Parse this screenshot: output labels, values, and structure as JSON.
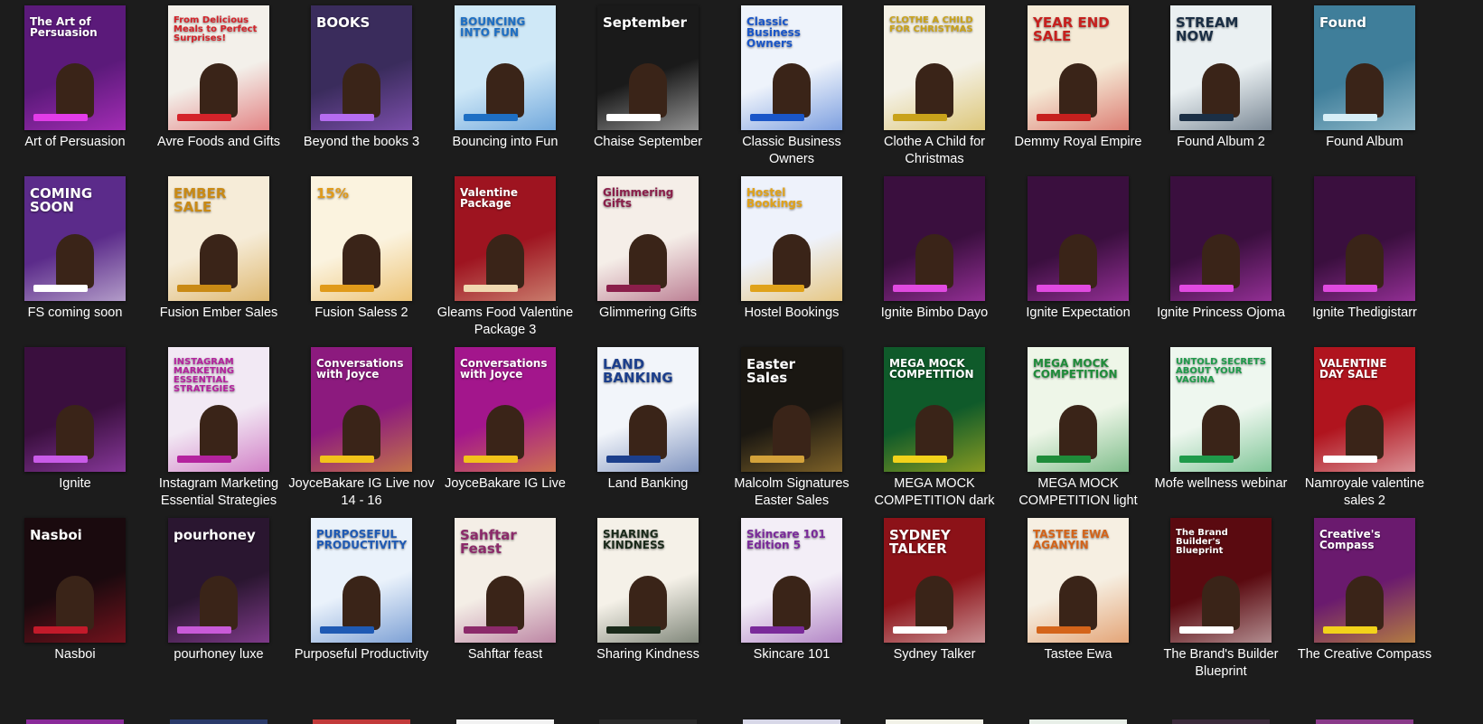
{
  "files": [
    {
      "label": "Art of Persuasion",
      "icon": "image-thumbnail-icon",
      "bg": "#5b1a7a",
      "accent": "#e23ce8",
      "headline": "The Art of Persuasion"
    },
    {
      "label": "Avre Foods and Gifts",
      "icon": "image-thumbnail-icon",
      "bg": "#f3f0ea",
      "accent": "#d4232a",
      "headline": "From Delicious Meals to Perfect Surprises!"
    },
    {
      "label": "Beyond the books 3",
      "icon": "image-thumbnail-icon",
      "bg": "#3a2c5c",
      "accent": "#b56cf0",
      "headline": "BOOKS"
    },
    {
      "label": "Bouncing into Fun",
      "icon": "image-thumbnail-icon",
      "bg": "#cfe8f7",
      "accent": "#1e6fc4",
      "headline": "BOUNCING INTO FUN"
    },
    {
      "label": "Chaise September",
      "icon": "image-thumbnail-icon",
      "bg": "#1a1a1a",
      "accent": "#ffffff",
      "headline": "September"
    },
    {
      "label": "Classic Business Owners",
      "icon": "image-thumbnail-icon",
      "bg": "#eef3fb",
      "accent": "#1a56c8",
      "headline": "Classic Business Owners"
    },
    {
      "label": "Clothe A Child for Christmas",
      "icon": "image-thumbnail-icon",
      "bg": "#f4f1e6",
      "accent": "#c9a21a",
      "headline": "CLOTHE A CHILD FOR CHRISTMAS"
    },
    {
      "label": "Demmy Royal Empire",
      "icon": "image-thumbnail-icon",
      "bg": "#f5ead6",
      "accent": "#c6201e",
      "headline": "YEAR END SALE"
    },
    {
      "label": "Found Album 2",
      "icon": "image-thumbnail-icon",
      "bg": "#eaf0f2",
      "accent": "#1b2f45",
      "headline": "STREAM NOW"
    },
    {
      "label": "Found Album",
      "icon": "image-thumbnail-icon",
      "bg": "#3f7e9a",
      "accent": "#d7eef6",
      "headline": "Found"
    },
    {
      "label": "FS coming soon",
      "icon": "image-thumbnail-icon",
      "bg": "#5b2b8a",
      "accent": "#ffffff",
      "headline": "COMING SOON"
    },
    {
      "label": "Fusion Ember Sales",
      "icon": "image-thumbnail-icon",
      "bg": "#f6ecd8",
      "accent": "#c98a15",
      "headline": "EMBER SALE"
    },
    {
      "label": "Fusion Saless 2",
      "icon": "image-thumbnail-icon",
      "bg": "#fbf3df",
      "accent": "#e09a1a",
      "headline": "15%"
    },
    {
      "label": "Gleams Food Valentine Package 3",
      "icon": "image-thumbnail-icon",
      "bg": "#9e1420",
      "accent": "#f0d8b0",
      "headline": "Valentine Package"
    },
    {
      "label": "Glimmering Gifts",
      "icon": "image-thumbnail-icon",
      "bg": "#f5eee8",
      "accent": "#8a1e4a",
      "headline": "Glimmering Gifts"
    },
    {
      "label": "Hostel Bookings",
      "icon": "image-thumbnail-icon",
      "bg": "#eef2fb",
      "accent": "#e0a21a",
      "headline": "Hostel Bookings"
    },
    {
      "label": "Ignite Bimbo Dayo",
      "icon": "image-thumbnail-icon",
      "bg": "#3a0f3e",
      "accent": "#e04ae0",
      "headline": ""
    },
    {
      "label": "Ignite Expectation",
      "icon": "image-thumbnail-icon",
      "bg": "#3a0f3e",
      "accent": "#e04ae0",
      "headline": ""
    },
    {
      "label": "Ignite Princess Ojoma",
      "icon": "image-thumbnail-icon",
      "bg": "#3a0f3e",
      "accent": "#e04ae0",
      "headline": ""
    },
    {
      "label": "Ignite Thedigistarr",
      "icon": "image-thumbnail-icon",
      "bg": "#3a0f3e",
      "accent": "#e04ae0",
      "headline": ""
    },
    {
      "label": "Ignite",
      "icon": "image-thumbnail-icon",
      "bg": "#3a0f3e",
      "accent": "#c95be8",
      "headline": ""
    },
    {
      "label": "Instagram Marketing Essential Strategies",
      "icon": "image-thumbnail-icon",
      "bg": "#f2e9f4",
      "accent": "#b4239e",
      "headline": "INSTAGRAM MARKETING ESSENTIAL STRATEGIES"
    },
    {
      "label": "JoyceBakare IG Live nov 14 - 16",
      "icon": "image-thumbnail-icon",
      "bg": "#8c1a7e",
      "accent": "#f2c21a",
      "headline": "Conversations with Joyce"
    },
    {
      "label": "JoyceBakare IG Live",
      "icon": "image-thumbnail-icon",
      "bg": "#a3168c",
      "accent": "#f2c21a",
      "headline": "Conversations with Joyce"
    },
    {
      "label": "Land Banking",
      "icon": "image-thumbnail-icon",
      "bg": "#f2f5fa",
      "accent": "#1c3f8c",
      "headline": "LAND BANKING"
    },
    {
      "label": "Malcolm Signatures Easter Sales",
      "icon": "image-thumbnail-icon",
      "bg": "#1a1712",
      "accent": "#d4a23a",
      "headline": "Easter Sales"
    },
    {
      "label": "MEGA MOCK COMPETITION dark",
      "icon": "image-thumbnail-icon",
      "bg": "#0f5a2a",
      "accent": "#f2d21a",
      "headline": "MEGA MOCK COMPETITION"
    },
    {
      "label": "MEGA MOCK COMPETITION light",
      "icon": "image-thumbnail-icon",
      "bg": "#eef6e8",
      "accent": "#1f8c3a",
      "headline": "MEGA MOCK COMPETITION"
    },
    {
      "label": "Mofe wellness webinar",
      "icon": "image-thumbnail-icon",
      "bg": "#eef7ef",
      "accent": "#1f9a4a",
      "headline": "UNTOLD SECRETS ABOUT YOUR VAGINA"
    },
    {
      "label": "Namroyale valentine sales 2",
      "icon": "image-thumbnail-icon",
      "bg": "#b0141e",
      "accent": "#ffffff",
      "headline": "VALENTINE DAY SALE"
    },
    {
      "label": "Nasboi",
      "icon": "image-thumbnail-icon",
      "bg": "#1a0a0e",
      "accent": "#c21a2a",
      "headline": "Nasboi"
    },
    {
      "label": "pourhoney luxe",
      "icon": "image-thumbnail-icon",
      "bg": "#2a1630",
      "accent": "#c85ad8",
      "headline": "pourhoney"
    },
    {
      "label": "Purposeful Productivity",
      "icon": "image-thumbnail-icon",
      "bg": "#eaf2fb",
      "accent": "#1f5ab4",
      "headline": "PURPOSEFUL PRODUCTIVITY"
    },
    {
      "label": "Sahftar feast",
      "icon": "image-thumbnail-icon",
      "bg": "#f4eee6",
      "accent": "#8c2a6a",
      "headline": "Sahftar Feast"
    },
    {
      "label": "Sharing Kindness",
      "icon": "image-thumbnail-icon",
      "bg": "#f5f1e8",
      "accent": "#1a2a1a",
      "headline": "SHARING KINDNESS"
    },
    {
      "label": "Skincare 101",
      "icon": "image-thumbnail-icon",
      "bg": "#f3eef7",
      "accent": "#7a2a9a",
      "headline": "Skincare 101 Edition 5"
    },
    {
      "label": "Sydney Talker",
      "icon": "image-thumbnail-icon",
      "bg": "#8c1218",
      "accent": "#ffffff",
      "headline": "SYDNEY TALKER"
    },
    {
      "label": "Tastee Ewa",
      "icon": "image-thumbnail-icon",
      "bg": "#f6efe2",
      "accent": "#d4641a",
      "headline": "TASTEE EWA AGANYIN"
    },
    {
      "label": "The Brand's Builder Blueprint",
      "icon": "image-thumbnail-icon",
      "bg": "#5a0a10",
      "accent": "#ffffff",
      "headline": "The Brand Builder's Blueprint"
    },
    {
      "label": "The Creative Compass",
      "icon": "image-thumbnail-icon",
      "bg": "#6a1a6e",
      "accent": "#f2d21a",
      "headline": "Creative's Compass"
    }
  ],
  "peek_row": [
    {
      "bg": "#8a2a9a"
    },
    {
      "bg": "#2a3a6a"
    },
    {
      "bg": "#c23a3a"
    },
    {
      "bg": "#f2f2f2"
    },
    {
      "bg": "#2a2a2a"
    },
    {
      "bg": "#d8d8e8"
    },
    {
      "bg": "#f2f2e8"
    },
    {
      "bg": "#e8efe8"
    },
    {
      "bg": "#3a2a3a"
    },
    {
      "bg": "#8a3a8a"
    }
  ]
}
